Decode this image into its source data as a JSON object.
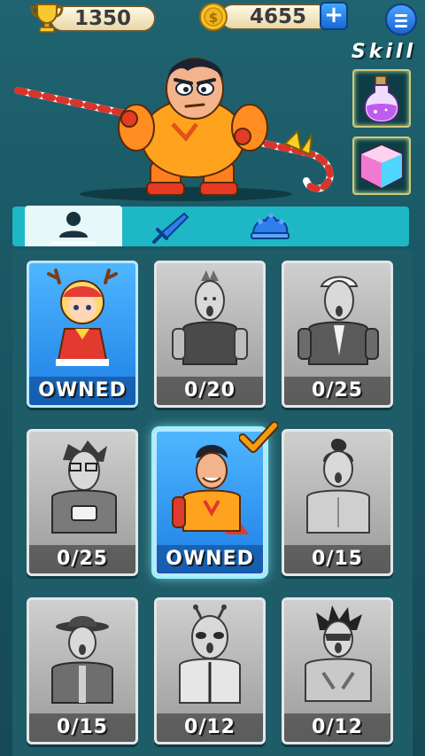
{
  "top_bar": {
    "trophies": "1350",
    "coins": "4655",
    "plus_label": "+"
  },
  "skill": {
    "label": "Skill",
    "slots": [
      "potion-icon",
      "magic-cube-icon"
    ]
  },
  "tabs": [
    {
      "icon": "person-icon",
      "active": true
    },
    {
      "icon": "sword-icon",
      "active": false
    },
    {
      "icon": "jester-hat-icon",
      "active": false
    }
  ],
  "characters": [
    {
      "status": "OWNED",
      "owned": true,
      "selected": false,
      "desc": "reindeer-girl"
    },
    {
      "status": "0/20",
      "owned": false,
      "selected": false,
      "desc": "mohawk"
    },
    {
      "status": "0/25",
      "owned": false,
      "selected": false,
      "desc": "suit"
    },
    {
      "status": "0/25",
      "owned": false,
      "selected": false,
      "desc": "glasses-hoodie"
    },
    {
      "status": "OWNED",
      "owned": true,
      "selected": true,
      "desc": "hero-cape"
    },
    {
      "status": "0/15",
      "owned": false,
      "selected": false,
      "desc": "topknot"
    },
    {
      "status": "0/15",
      "owned": false,
      "selected": false,
      "desc": "fedora"
    },
    {
      "status": "0/12",
      "owned": false,
      "selected": false,
      "desc": "alien"
    },
    {
      "status": "0/12",
      "owned": false,
      "selected": false,
      "desc": "spiky-mask"
    }
  ],
  "colors": {
    "background": "#1a5663",
    "tab_bar": "#1eb7c5",
    "owned_card": "#1d7fe5",
    "locked_card": "#9a9a9a",
    "check": "#f39c12"
  }
}
